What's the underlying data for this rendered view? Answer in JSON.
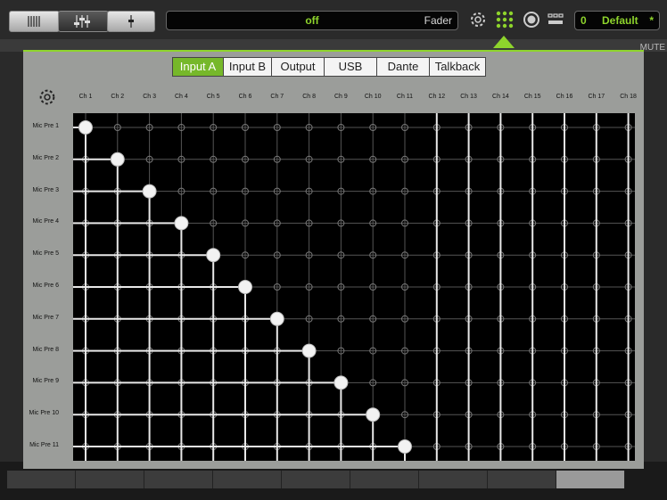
{
  "topbar": {
    "status_text": "off",
    "mode_label": "Fader",
    "scene_number": "0",
    "scene_name": "Default",
    "scene_modified": "*",
    "accent_color": "#8ed42c"
  },
  "background": {
    "right_label": "MUTE"
  },
  "tabs": [
    {
      "label": "Input A",
      "active": true
    },
    {
      "label": "Input B",
      "active": false
    },
    {
      "label": "Output",
      "active": false
    },
    {
      "label": "USB",
      "active": false
    },
    {
      "label": "Dante",
      "active": false
    },
    {
      "label": "Talkback",
      "active": false
    }
  ],
  "channels": [
    "Ch 1",
    "Ch 2",
    "Ch 3",
    "Ch 4",
    "Ch 5",
    "Ch 6",
    "Ch 7",
    "Ch 8",
    "Ch 9",
    "Ch 10",
    "Ch 11",
    "Ch 12",
    "Ch 13",
    "Ch 14",
    "Ch 15",
    "Ch 16",
    "Ch 17",
    "Ch 18"
  ],
  "inputs": [
    "Mic Pre 1",
    "Mic Pre 2",
    "Mic Pre 3",
    "Mic Pre 4",
    "Mic Pre 5",
    "Mic Pre 6",
    "Mic Pre 7",
    "Mic Pre 8",
    "Mic Pre 9",
    "Mic Pre 10",
    "Mic Pre 11"
  ],
  "routes": [
    {
      "input": "Mic Pre 1",
      "channel": "Ch 1"
    },
    {
      "input": "Mic Pre 2",
      "channel": "Ch 2"
    },
    {
      "input": "Mic Pre 3",
      "channel": "Ch 3"
    },
    {
      "input": "Mic Pre 4",
      "channel": "Ch 4"
    },
    {
      "input": "Mic Pre 5",
      "channel": "Ch 5"
    },
    {
      "input": "Mic Pre 6",
      "channel": "Ch 6"
    },
    {
      "input": "Mic Pre 7",
      "channel": "Ch 7"
    },
    {
      "input": "Mic Pre 8",
      "channel": "Ch 8"
    },
    {
      "input": "Mic Pre 9",
      "channel": "Ch 9"
    },
    {
      "input": "Mic Pre 10",
      "channel": "Ch 10"
    },
    {
      "input": "Mic Pre 11",
      "channel": "Ch 11"
    }
  ]
}
